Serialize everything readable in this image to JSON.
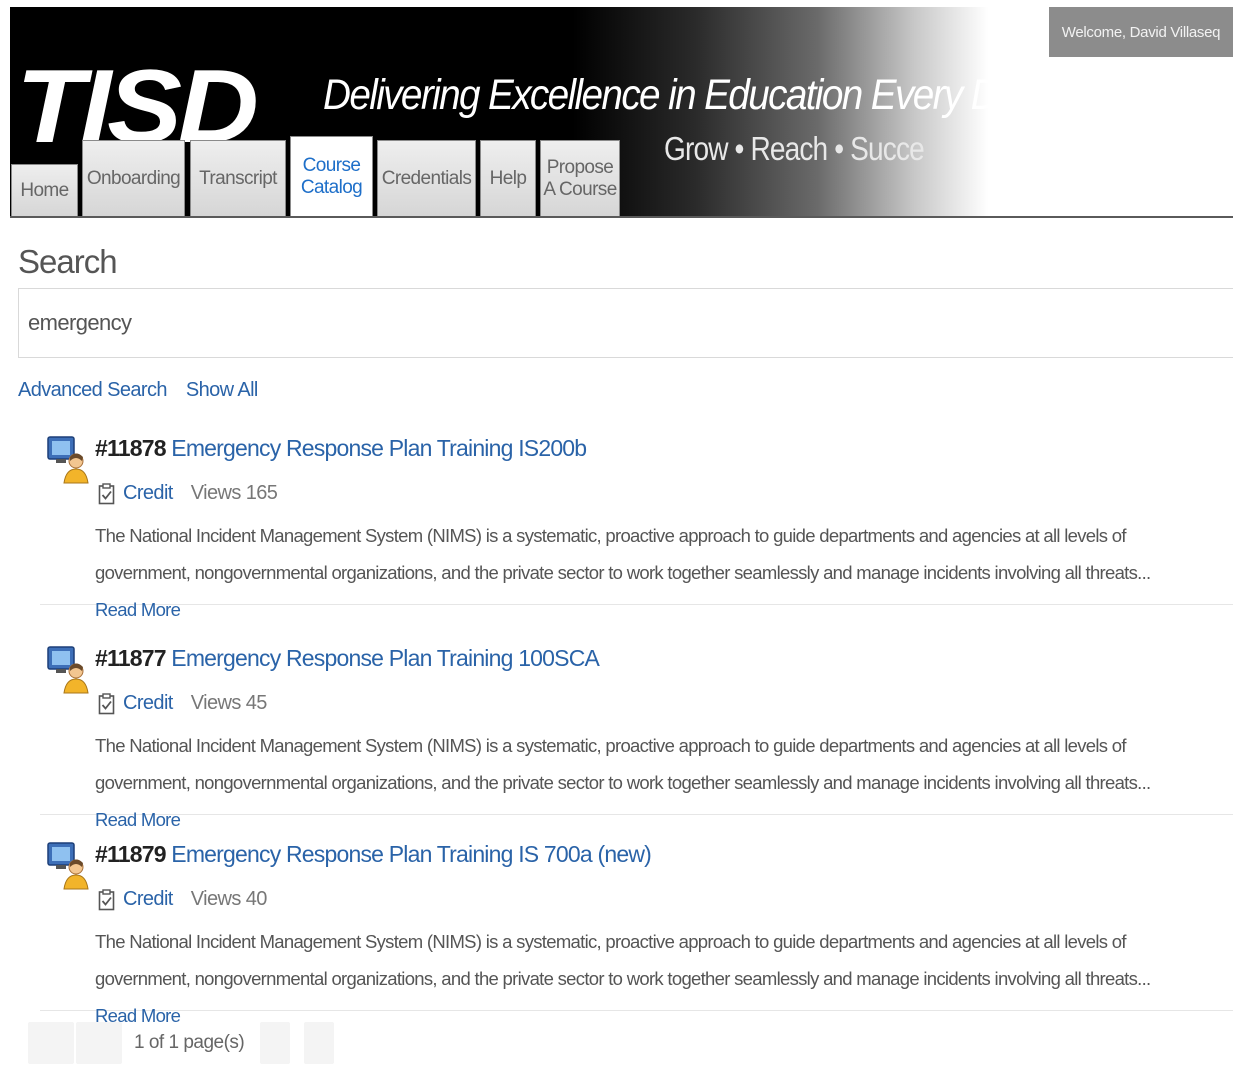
{
  "header": {
    "logo": "TISD",
    "tagline": "Delivering Excellence in Education Every D",
    "subtagline": "Grow • Reach • Succe",
    "welcome": "Welcome, David Villaseq"
  },
  "tabs": [
    {
      "label_line1": "Home",
      "label_line2": ""
    },
    {
      "label_line1": "Onboarding",
      "label_line2": ""
    },
    {
      "label_line1": "Transcript",
      "label_line2": ""
    },
    {
      "label_line1": "Course",
      "label_line2": "Catalog"
    },
    {
      "label_line1": "Credentials",
      "label_line2": ""
    },
    {
      "label_line1": "Help",
      "label_line2": ""
    },
    {
      "label_line1": "Propose",
      "label_line2": "A Course"
    }
  ],
  "active_tab": "Course Catalog",
  "search": {
    "heading": "Search",
    "value": "emergency",
    "advanced_link": "Advanced Search",
    "show_all_link": "Show All"
  },
  "results": [
    {
      "number": "#11878",
      "title": "Emergency Response Plan Training IS200b",
      "credit": "Credit",
      "views": "Views 165",
      "description": "The National Incident Management System (NIMS) is a systematic, proactive approach to guide departments and agencies at all levels of government, nongovernmental organizations, and the private sector to work together seamlessly and manage incidents involving all threats...",
      "read_more": "Read More"
    },
    {
      "number": "#11877",
      "title": "Emergency Response Plan Training 100SCA",
      "credit": "Credit",
      "views": "Views 45",
      "description": "The National Incident Management System (NIMS) is a systematic, proactive approach to guide departments and agencies at all levels of government, nongovernmental organizations, and the private sector to work together seamlessly and manage incidents involving all threats...",
      "read_more": "Read More"
    },
    {
      "number": "#11879",
      "title": "Emergency Response Plan Training IS 700a (new)",
      "credit": "Credit",
      "views": "Views 40",
      "description": "The National Incident Management System (NIMS) is a systematic, proactive approach to guide departments and agencies at all levels of government, nongovernmental organizations, and the private sector to work together seamlessly and manage incidents involving all threats...",
      "read_more": "Read More"
    }
  ],
  "pager": {
    "text": "1 of 1 page(s)"
  },
  "colors": {
    "link": "#2a63a8",
    "active_tab_text": "#1e6fc9",
    "welcome_bg": "#8c8c8c"
  }
}
